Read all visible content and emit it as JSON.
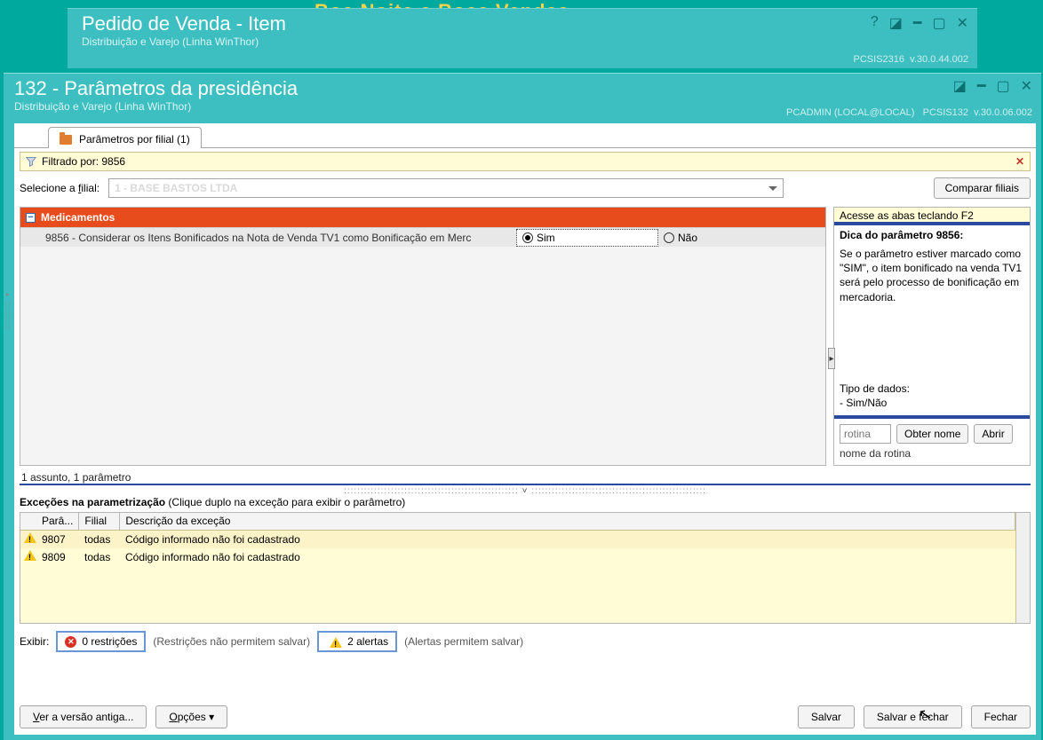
{
  "banner_text": "Boa Noite e Boas Vendas",
  "back_window": {
    "title": "Pedido de Venda - Item",
    "subtitle": "Distribuição e Varejo (Linha WinThor)",
    "module": "PCSIS2316",
    "version": "v.30.0.44.002"
  },
  "front_window": {
    "title": "132 - Parâmetros da presidência",
    "subtitle": "Distribuição e Varejo (Linha WinThor)",
    "user": "PCADMIN (LOCAL@LOCAL)",
    "module": "PCSIS132",
    "version": "v.30.0.06.002"
  },
  "tab": {
    "label": "Parâmetros por filial  (1)"
  },
  "filter": {
    "label": "Filtrado por: 9856"
  },
  "filial": {
    "label_pre": "Selecione a ",
    "label_u": "f",
    "label_post": "ilial:",
    "selected": "1 - BASE BASTOS LTDA",
    "compare_btn": "Comparar filiais"
  },
  "grid": {
    "section": "Medicamentos",
    "row_text": "9856 - Considerar os Itens Bonificados na Nota de Venda TV1 como Bonificação em Merc",
    "opt_yes": "Sim",
    "opt_no": "Não",
    "status": "1 assunto, 1 parâmetro"
  },
  "hint": {
    "tip_line": "Acesse as abas teclando F2",
    "title": "Dica do parâmetro 9856:",
    "body": "Se o parâmetro estiver marcado como \"SIM\", o item bonificado na venda TV1 será pelo processo de bonificação em mercadoria.",
    "datatype_lbl": "Tipo de dados:",
    "datatype_val": "  - Sim/Não",
    "rotina_ph": "rotina",
    "obter": "Obter nome",
    "abrir": "Abrir",
    "rotina_name": "nome da rotina"
  },
  "exceptions": {
    "heading_b": "Exceções na parametrização",
    "heading_rest": "   (Clique duplo na exceção para exibir o parâmetro)",
    "cols": {
      "para": "Parâ...",
      "filial": "Filial",
      "desc": "Descrição da exceção"
    },
    "rows": [
      {
        "para": "9807",
        "filial": "todas",
        "desc": "Código informado não foi cadastrado"
      },
      {
        "para": "9809",
        "filial": "todas",
        "desc": "Código informado não foi cadastrado"
      }
    ]
  },
  "exibir": {
    "label": "Exibir:",
    "restr_btn": "0 restrições",
    "restr_note": "(Restrições não permitem salvar)",
    "alert_btn": "2 alertas",
    "alert_note": "(Alertas permitem salvar)"
  },
  "buttons": {
    "ver_old_pre": "V",
    "ver_old_post": "er a versão antiga...",
    "opcoes_pre": "O",
    "opcoes_post": "pções ▾",
    "salvar": "Salvar",
    "salvar_fechar": "Salvar e fechar",
    "fechar": "Fechar"
  }
}
